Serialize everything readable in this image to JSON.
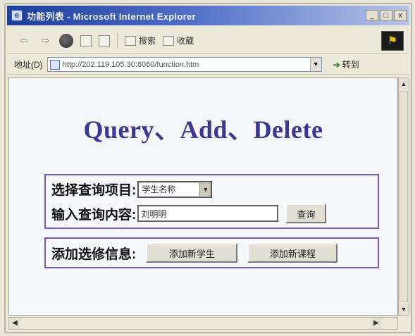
{
  "window": {
    "title": "功能列表 - Microsoft Internet Explorer",
    "controls": [
      "_",
      "□",
      "x"
    ]
  },
  "toolbar": {
    "search_label": "搜索",
    "favorites_label": "收藏"
  },
  "addressbar": {
    "label": "地址(D)",
    "url": "http://202.119.105.30:8080/function.htm",
    "go_label": "转到"
  },
  "page": {
    "title": "Query、Add、Delete"
  },
  "query_panel": {
    "select_label": "选择查询项目:",
    "select_value": "学生名称",
    "input_label": "输入查询内容:",
    "input_value": "刘明明",
    "query_button": "查询"
  },
  "add_panel": {
    "label": "添加选修信息:",
    "add_student_button": "添加新学生",
    "add_course_button": "添加新课程"
  },
  "icons": {
    "back": "back-arrow-icon",
    "forward": "forward-arrow-icon",
    "stop": "stop-icon",
    "refresh": "refresh-icon",
    "home": "home-icon"
  },
  "colors": {
    "title_text": "#3b3795",
    "panel_border": "#7a58c8",
    "titlebar": "#1d3d9c"
  }
}
